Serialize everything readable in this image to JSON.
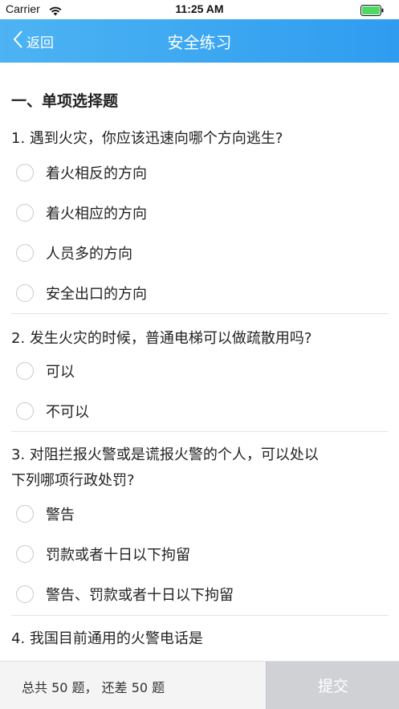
{
  "status_bar": {
    "carrier": "Carrier",
    "time": "11:25 AM",
    "battery_color": "#4cd964"
  },
  "nav": {
    "back_label": "返回",
    "title": "安全练习",
    "accent": "#3aa6f1"
  },
  "section": {
    "heading": "一、单项选择题"
  },
  "questions": [
    {
      "text": "1. 遇到火灾，你应该迅速向哪个方向逃生?",
      "options": [
        "着火相反的方向",
        "着火相应的方向",
        "人员多的方向",
        "安全出口的方向"
      ]
    },
    {
      "text": "2. 发生火灾的时候，普通电梯可以做疏散用吗?",
      "options": [
        "可以",
        "不可以"
      ]
    },
    {
      "text_line1": "3. 对阻拦报火警或是谎报火警的个人，可以处以",
      "text_line2": "下列哪项行政处罚?",
      "options": [
        "警告",
        "罚款或者十日以下拘留",
        "警告、罚款或者十日以下拘留"
      ]
    },
    {
      "text": "4. 我国目前通用的火警电话是"
    }
  ],
  "footer": {
    "summary": "总共 50 题， 还差 50 题",
    "submit_label": "提交"
  }
}
